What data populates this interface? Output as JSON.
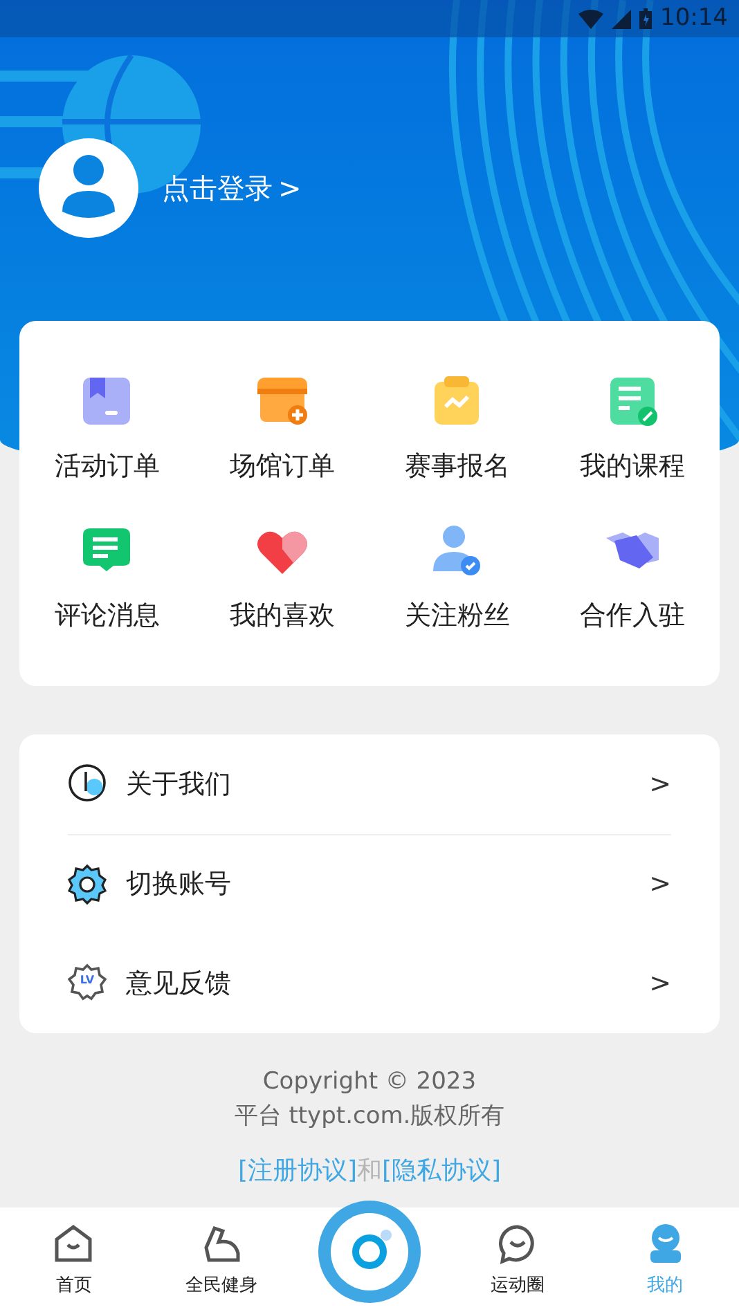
{
  "status_bar": {
    "time": "10:14"
  },
  "profile": {
    "login_label": "点击登录",
    "chevron": ">"
  },
  "shortcuts": [
    {
      "kind": "bookmark",
      "label": "活动订单"
    },
    {
      "kind": "store",
      "label": "场馆订单"
    },
    {
      "kind": "clipboard",
      "label": "赛事报名"
    },
    {
      "kind": "document",
      "label": "我的课程"
    },
    {
      "kind": "chat",
      "label": "评论消息"
    },
    {
      "kind": "heart",
      "label": "我的喜欢"
    },
    {
      "kind": "user",
      "label": "关注粉丝"
    },
    {
      "kind": "handshake",
      "label": "合作入驻"
    }
  ],
  "menu": [
    {
      "kind": "about",
      "label": "关于我们",
      "chevron": ">"
    },
    {
      "kind": "gear",
      "label": "切换账号",
      "chevron": ">"
    },
    {
      "kind": "badge",
      "badge_text": "LV",
      "label": "意见反馈",
      "chevron": ">"
    }
  ],
  "footer": {
    "copyright": "Copyright © 2023",
    "owner": "平台 ttypt.com.版权所有",
    "links": [
      {
        "label": "[注册协议]"
      },
      {
        "label": "[隐私协议]"
      }
    ],
    "joiner": "和"
  },
  "tabs": [
    {
      "kind": "home",
      "label": "首页",
      "selected": false
    },
    {
      "kind": "muscle",
      "label": "全民健身",
      "selected": false
    },
    {
      "kind": "center"
    },
    {
      "kind": "chat",
      "label": "运动圈",
      "selected": false
    },
    {
      "kind": "me",
      "label": "我的",
      "selected": true
    }
  ]
}
